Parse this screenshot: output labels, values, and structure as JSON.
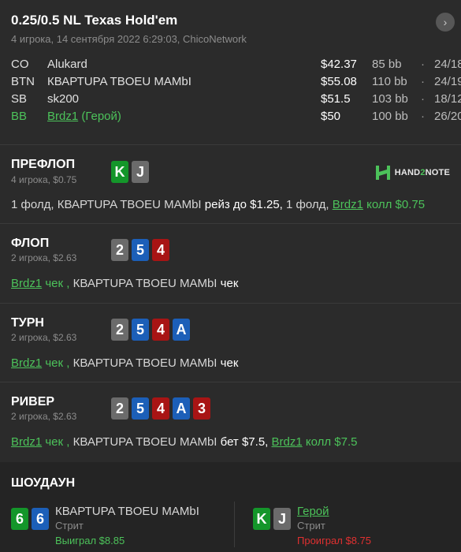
{
  "header": {
    "title": "0.25/0.5 NL Texas Hold'em",
    "subtitle": "4 игрока, 14 сентября 2022 6:29:03, ChicoNetwork",
    "next_icon": "chevron-right-icon"
  },
  "players": [
    {
      "pos": "CO",
      "name": "Alukard",
      "stack": "$42.37",
      "bb": "85 bb",
      "dot": "·",
      "ratio": "24/18"
    },
    {
      "pos": "BTN",
      "name": "КВАРТUPA TBOEU MAMbI",
      "stack": "$55.08",
      "bb": "110 bb",
      "dot": "·",
      "ratio": "24/19"
    },
    {
      "pos": "SB",
      "name": "sk200",
      "stack": "$51.5",
      "bb": "103 bb",
      "dot": "·",
      "ratio": "18/12"
    },
    {
      "pos": "BB",
      "name": "Brdz1",
      "hero_suffix": "(Герой)",
      "stack": "$50",
      "bb": "100 bb",
      "dot": "·",
      "ratio": "26/20"
    }
  ],
  "logo": {
    "text_a": "HAND",
    "text_b": "2",
    "text_c": "NOTE"
  },
  "streets": {
    "preflop": {
      "name": "ПРЕФЛОП",
      "sub": "4 игрока, $0.75",
      "cards": [
        {
          "rank": "K",
          "color": "#14962a"
        },
        {
          "rank": "J",
          "color": "#6b6b6b"
        }
      ],
      "action": {
        "a1": "1 фолд, КВАРТUPA TBOEU MAMbI",
        "a2": "рейз до $1.25,",
        "a3": "1 фолд,",
        "a4": "Brdz1",
        "a5": "колл $0.75"
      }
    },
    "flop": {
      "name": "ФЛОП",
      "sub": "2 игрока, $2.63",
      "cards": [
        {
          "rank": "2",
          "color": "#6b6b6b"
        },
        {
          "rank": "5",
          "color": "#1c5fb8"
        },
        {
          "rank": "4",
          "color": "#a81414"
        }
      ],
      "action": {
        "a1": "Brdz1",
        "a2": "чек ,",
        "a3": "КВАРТUPA TBOEU MAMbI",
        "a4": "чек"
      }
    },
    "turn": {
      "name": "ТУРН",
      "sub": "2 игрока, $2.63",
      "cards": [
        {
          "rank": "2",
          "color": "#6b6b6b"
        },
        {
          "rank": "5",
          "color": "#1c5fb8"
        },
        {
          "rank": "4",
          "color": "#a81414"
        },
        {
          "rank": "A",
          "color": "#1c5fb8"
        }
      ],
      "action": {
        "a1": "Brdz1",
        "a2": "чек ,",
        "a3": "КВАРТUPA TBOEU MAMbI",
        "a4": "чек"
      }
    },
    "river": {
      "name": "РИВЕР",
      "sub": "2 игрока, $2.63",
      "cards": [
        {
          "rank": "2",
          "color": "#6b6b6b"
        },
        {
          "rank": "5",
          "color": "#1c5fb8"
        },
        {
          "rank": "4",
          "color": "#a81414"
        },
        {
          "rank": "A",
          "color": "#1c5fb8"
        },
        {
          "rank": "3",
          "color": "#a81414"
        }
      ],
      "action": {
        "a1": "Brdz1",
        "a2": "чек ,",
        "a3": "КВАРТUPA TBOEU MAMbI",
        "a4": "бет $7.5,",
        "a5": "Brdz1",
        "a6": "колл $7.5"
      }
    }
  },
  "showdown": {
    "title": "ШОУДАУН",
    "villain": {
      "cards": [
        {
          "rank": "6",
          "color": "#14962a"
        },
        {
          "rank": "6",
          "color": "#1c5fb8"
        }
      ],
      "name": "КВАРТUPA TBOEU MAMbI",
      "hand": "Стрит",
      "result": "Выиграл $8.85"
    },
    "hero": {
      "cards": [
        {
          "rank": "K",
          "color": "#14962a"
        },
        {
          "rank": "J",
          "color": "#6b6b6b"
        }
      ],
      "name": "Герой",
      "hand": "Стрит",
      "result": "Проиграл $8.75"
    }
  }
}
